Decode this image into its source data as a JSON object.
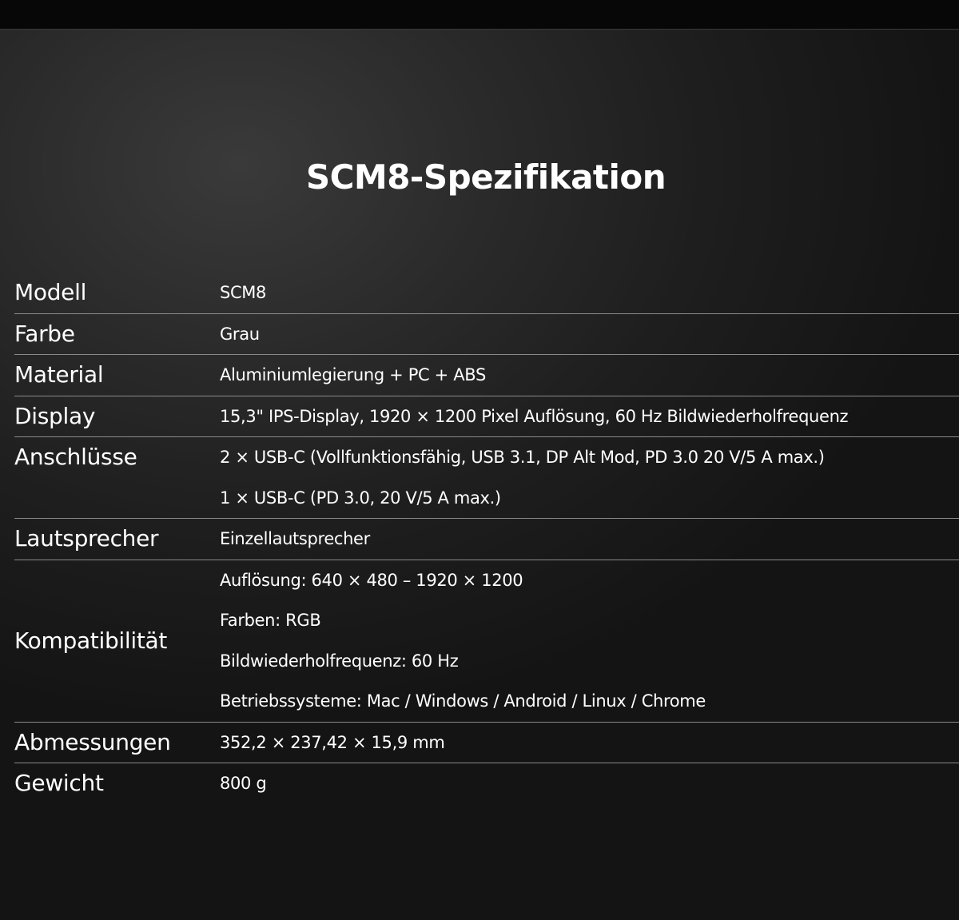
{
  "page": {
    "title": "SCM8-Spezifikation"
  },
  "specs": [
    {
      "label": "Modell",
      "values": [
        "SCM8"
      ]
    },
    {
      "label": "Farbe",
      "values": [
        "Grau"
      ]
    },
    {
      "label": "Material",
      "values": [
        "Aluminiumlegierung + PC + ABS"
      ]
    },
    {
      "label": "Display",
      "values": [
        "15,3\" IPS-Display, 1920 × 1200 Pixel Auflösung, 60 Hz Bildwiederholfrequenz"
      ]
    },
    {
      "label": "Anschlüsse",
      "values": [
        "2 × USB-C (Vollfunktionsfähig, USB 3.1, DP Alt Mod, PD 3.0 20 V/5 A max.)",
        "1 × USB-C (PD 3.0, 20 V/5 A max.)"
      ]
    },
    {
      "label": "Lautsprecher",
      "values": [
        "Einzellautsprecher"
      ]
    },
    {
      "label": "Kompatibilität",
      "values": [
        "Auflösung: 640 × 480 – 1920 × 1200",
        "Farben: RGB",
        "Bildwiederholfrequenz: 60 Hz",
        "Betriebssysteme: Mac / Windows / Android / Linux / Chrome"
      ]
    },
    {
      "label": "Abmessungen",
      "values": [
        "352,2 × 237,42 × 15,9 mm"
      ]
    },
    {
      "label": "Gewicht",
      "values": [
        "800 g"
      ]
    }
  ],
  "colors": {
    "text": "#ffffff",
    "divider": "#8a8a8a",
    "top_bar": "#070707"
  }
}
